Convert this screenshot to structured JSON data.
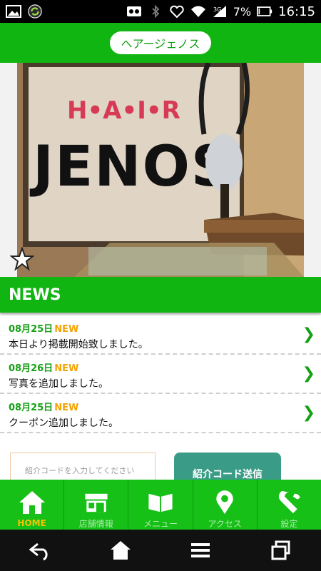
{
  "status_bar": {
    "battery": "7%",
    "time": "16:15",
    "icons": [
      "gallery-icon",
      "sync-icon",
      "cast-icon",
      "bluetooth-icon",
      "heart-icon",
      "wifi-icon",
      "signal-icon",
      "battery-icon"
    ]
  },
  "header": {
    "title": "ヘアージェノス"
  },
  "hero": {
    "sign_top": "H•A•I•R",
    "sign_main": "JENOS"
  },
  "news": {
    "heading": "NEWS",
    "items": [
      {
        "date": "08月25日",
        "badge": "NEW",
        "title": "本日より掲載開始致しました。"
      },
      {
        "date": "08月26日",
        "badge": "NEW",
        "title": "写真を追加しました。"
      },
      {
        "date": "08月25日",
        "badge": "NEW",
        "title": "クーポン追加しました。"
      }
    ]
  },
  "referral": {
    "placeholder": "紹介コードを入力してください",
    "button": "紹介コード送信"
  },
  "tabs": [
    {
      "label": "HOME",
      "icon": "home-icon"
    },
    {
      "label": "店舗情報",
      "icon": "store-icon"
    },
    {
      "label": "メニュー",
      "icon": "book-icon"
    },
    {
      "label": "アクセス",
      "icon": "map-pin-icon"
    },
    {
      "label": "設定",
      "icon": "wrench-icon"
    }
  ],
  "colors": {
    "primary_green": "#11b511",
    "new_badge": "#f5a300",
    "referral_button": "#3a9c86"
  }
}
